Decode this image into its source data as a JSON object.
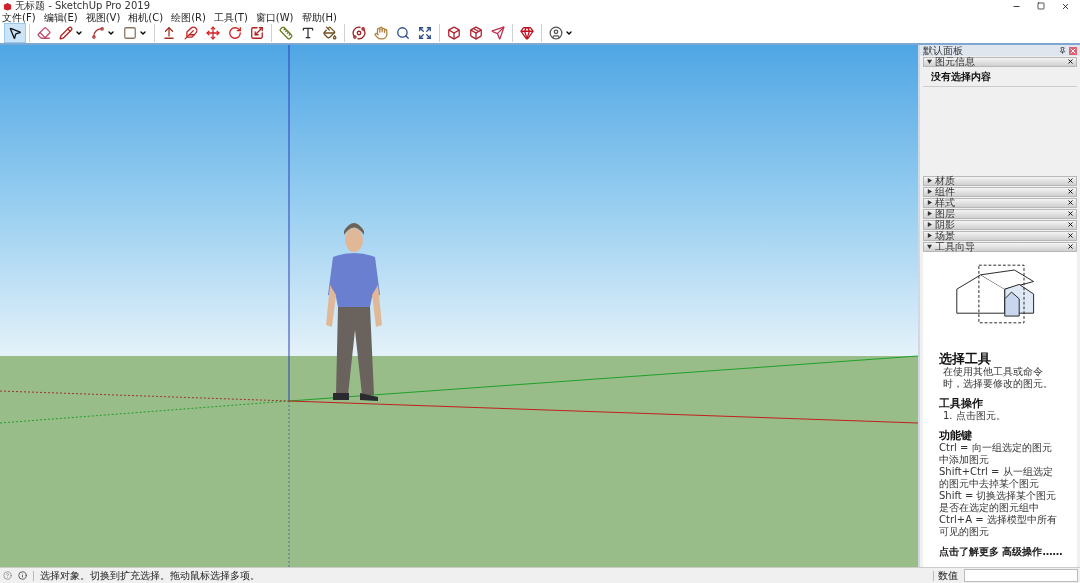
{
  "window": {
    "title": "无标题 - SketchUp Pro 2019"
  },
  "menu": [
    "文件(F)",
    "编辑(E)",
    "视图(V)",
    "相机(C)",
    "绘图(R)",
    "工具(T)",
    "窗口(W)",
    "帮助(H)"
  ],
  "toolbar": [
    {
      "selected": true
    },
    {
      "selected": false
    },
    {
      "selected": false
    },
    {
      "selected": false
    },
    {
      "selected": false
    },
    {
      "selected": false
    },
    {
      "selected": false
    },
    {
      "selected": false
    },
    {
      "selected": false
    },
    {
      "selected": false
    },
    {
      "selected": false
    },
    {
      "selected": false
    },
    {
      "selected": false
    },
    {
      "selected": false
    },
    {
      "selected": false
    },
    {
      "selected": false
    },
    {
      "selected": false
    },
    {
      "selected": false
    },
    {
      "selected": false
    },
    {
      "selected": false
    },
    {
      "selected": false
    },
    {
      "selected": false
    }
  ],
  "panel": {
    "title": "默认面板",
    "sections": [
      {
        "kind": "info",
        "title": "图元信息",
        "expanded": true,
        "content": "没有选择内容"
      },
      {
        "kind": "plain",
        "title": "材质",
        "expanded": false
      },
      {
        "kind": "plain",
        "title": "组件",
        "expanded": false
      },
      {
        "kind": "plain",
        "title": "样式",
        "expanded": false
      },
      {
        "kind": "plain",
        "title": "图层",
        "expanded": false
      },
      {
        "kind": "plain",
        "title": "阴影",
        "expanded": false
      },
      {
        "kind": "plain",
        "title": "场景",
        "expanded": false
      },
      {
        "kind": "guide",
        "title": "工具向导",
        "expanded": true,
        "guide": {
          "heading": "选择工具",
          "description": "在使用其他工具或命令时，选择要修改的图元。",
          "operations_title": "工具操作",
          "operations": [
            "1. 点击图元。"
          ],
          "keys_title": "功能键",
          "keys": [
            "Ctrl = 向一组选定的图元中添加图元",
            "Shift+Ctrl = 从一组选定的图元中去掉某个图元",
            "Shift = 切换选择某个图元是否在选定的图元组中",
            "Ctrl+A = 选择模型中所有可见的图元"
          ],
          "link": "点击了解更多 高级操作……"
        }
      }
    ]
  },
  "status_bar": {
    "message": "选择对象。切换到扩充选择。拖动鼠标选择多项。",
    "value_label": "数值"
  }
}
